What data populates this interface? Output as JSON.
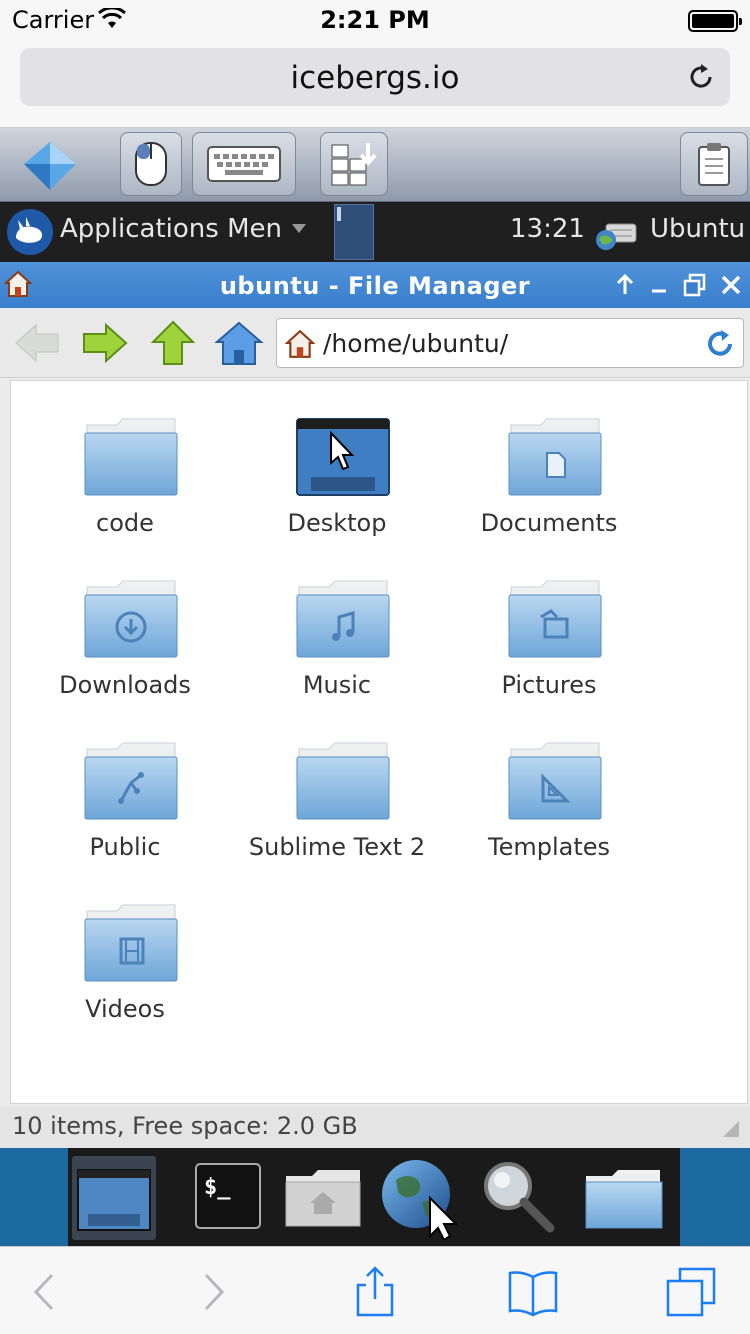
{
  "status_bar": {
    "carrier": "Carrier",
    "time": "2:21 PM"
  },
  "safari": {
    "url": "icebergs.io"
  },
  "panel": {
    "apps_menu": "Applications Men",
    "clock": "13:21",
    "user": "Ubuntu"
  },
  "file_manager": {
    "title": "ubuntu - File Manager",
    "location": "/home/ubuntu/",
    "status": "10 items, Free space: 2.0 GB",
    "items": [
      {
        "name": "code",
        "icon": "folder-icon"
      },
      {
        "name": "Desktop",
        "icon": "desktop-folder-icon"
      },
      {
        "name": "Documents",
        "icon": "documents-folder-icon"
      },
      {
        "name": "Downloads",
        "icon": "downloads-folder-icon"
      },
      {
        "name": "Music",
        "icon": "music-folder-icon"
      },
      {
        "name": "Pictures",
        "icon": "pictures-folder-icon"
      },
      {
        "name": "Public",
        "icon": "public-folder-icon"
      },
      {
        "name": "Sublime Text 2",
        "icon": "folder-icon"
      },
      {
        "name": "Templates",
        "icon": "templates-folder-icon"
      },
      {
        "name": "Videos",
        "icon": "videos-folder-icon"
      }
    ]
  },
  "colors": {
    "titlebar": "#3a7fcc",
    "panel": "#1f1f1f",
    "dock_bg": "#1c6aa0",
    "folder": "#7fb2de"
  }
}
